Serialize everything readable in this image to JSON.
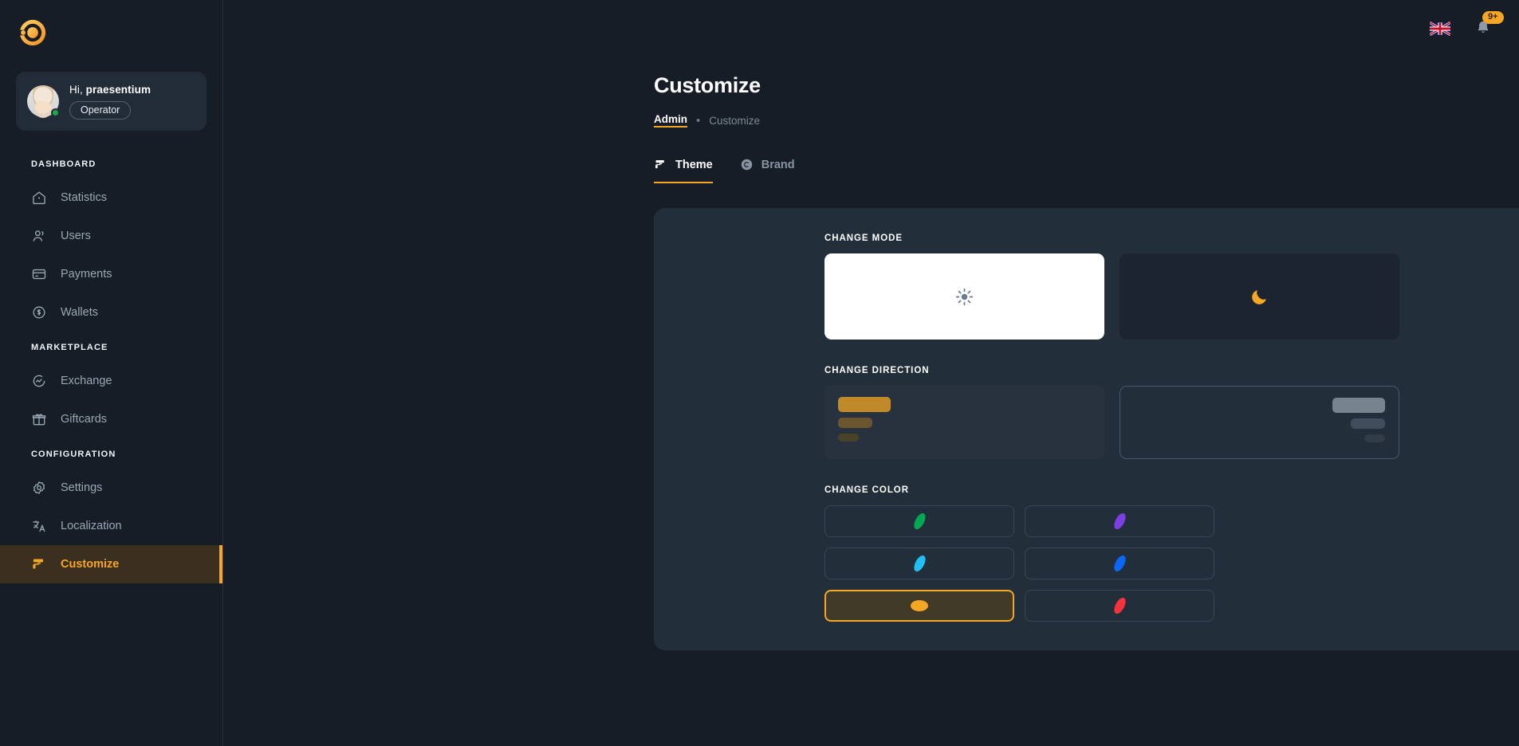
{
  "brand": {
    "accent": "#f5a623",
    "logo_icon": "circle-c-logo"
  },
  "sidebar": {
    "profile": {
      "greeting": "Hi,",
      "username": "praesentium",
      "role": "Operator",
      "avatar_icon": "user-avatar",
      "status_icon": "online-status-dot"
    },
    "groups": [
      {
        "label": "DASHBOARD",
        "items": [
          {
            "label": "Statistics",
            "icon": "home-icon",
            "active": false
          },
          {
            "label": "Users",
            "icon": "users-icon",
            "active": false
          },
          {
            "label": "Payments",
            "icon": "credit-card-icon",
            "active": false
          },
          {
            "label": "Wallets",
            "icon": "coin-icon",
            "active": false
          }
        ]
      },
      {
        "label": "MARKETPLACE",
        "items": [
          {
            "label": "Exchange",
            "icon": "exchange-chart-icon",
            "active": false
          },
          {
            "label": "Giftcards",
            "icon": "gift-icon",
            "active": false
          }
        ]
      },
      {
        "label": "CONFIGURATION",
        "items": [
          {
            "label": "Settings",
            "icon": "gear-icon",
            "active": false
          },
          {
            "label": "Localization",
            "icon": "translate-icon",
            "active": false
          },
          {
            "label": "Customize",
            "icon": "paint-roller-icon",
            "active": true
          }
        ]
      }
    ]
  },
  "topbar": {
    "language_flag": "uk-flag-icon",
    "notifications": {
      "icon": "bell-icon",
      "count": "9+"
    },
    "apps": {
      "icon": "grid-apps-icon"
    }
  },
  "page": {
    "title": "Customize",
    "breadcrumb": {
      "parent": "Admin",
      "separator": "•",
      "current": "Customize"
    }
  },
  "tabs": [
    {
      "label": "Theme",
      "icon": "paint-roller-icon",
      "active": true
    },
    {
      "label": "Brand",
      "icon": "copyright-circle-icon",
      "active": false
    }
  ],
  "theme_panel": {
    "change_mode": {
      "label": "CHANGE MODE",
      "options": [
        {
          "name": "light",
          "icon": "sun-icon",
          "selected": false
        },
        {
          "name": "dark",
          "icon": "moon-icon",
          "selected": true
        }
      ]
    },
    "change_direction": {
      "label": "CHANGE DIRECTION",
      "options": [
        {
          "name": "ltr",
          "selected": true
        },
        {
          "name": "rtl",
          "selected": false
        }
      ]
    },
    "change_color": {
      "label": "CHANGE COLOR",
      "options": [
        {
          "name": "green",
          "hex": "#00a854",
          "selected": false
        },
        {
          "name": "purple",
          "hex": "#7b3fe4",
          "selected": false
        },
        {
          "name": "cyan",
          "hex": "#1ec0f5",
          "selected": false
        },
        {
          "name": "blue",
          "hex": "#0a66f5",
          "selected": false
        },
        {
          "name": "orange",
          "hex": "#f5a623",
          "selected": true
        },
        {
          "name": "red",
          "hex": "#f5333f",
          "selected": false
        }
      ]
    }
  }
}
